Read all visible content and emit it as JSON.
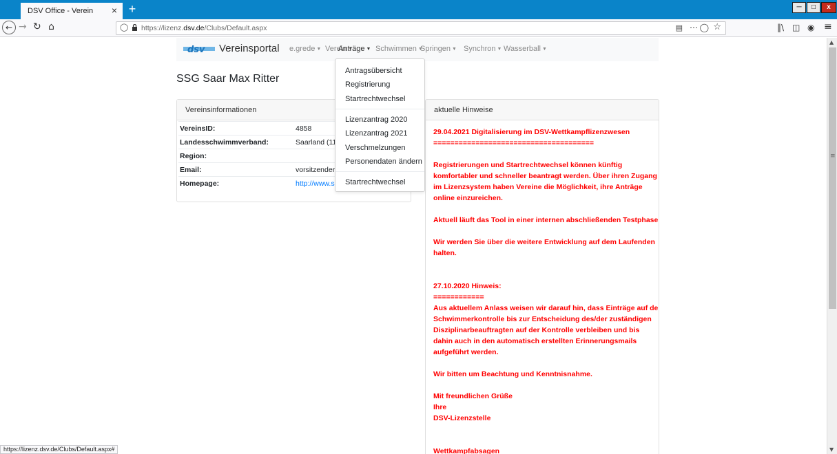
{
  "browser": {
    "tab_title": "DSV Office - Verein",
    "tab_close": "×",
    "new_tab": "+",
    "url_prefix": "https://lizenz.",
    "url_domain": "dsv.de",
    "url_path": "/Clubs/Default.aspx",
    "status_url": "https://lizenz.dsv.de/Clubs/Default.aspx#"
  },
  "site": {
    "brand": "Vereinsportal",
    "nav": {
      "egrede": "e.grede",
      "verein": "Verein",
      "antraege": "Anträge",
      "schwimmen": "Schwimmen",
      "springen": "Springen",
      "synchron": "Synchron",
      "wasserball": "Wasserball"
    },
    "dropdown": [
      "Antragsübersicht",
      "Registrierung",
      "Startrechtwechsel",
      "Lizenzantrag 2020",
      "Lizenzantrag 2021",
      "Verschmelzungen",
      "Personendaten ändern",
      "Startrechtwechsel"
    ]
  },
  "club": {
    "title": "SSG Saar Max Ritter",
    "card_title": "Vereinsinformationen",
    "rows": [
      {
        "label": "VereinsID:",
        "value": "4858"
      },
      {
        "label": "Landesschwimmverband:",
        "value": "Saarland (11)"
      },
      {
        "label": "Region:",
        "value": ""
      },
      {
        "label": "Email:",
        "value": "vorsitzender@"
      },
      {
        "label": "Homepage:",
        "value": "http://www.ss"
      }
    ]
  },
  "hints": {
    "card_title": "aktuelle Hinweise",
    "lines": [
      "29.04.2021 Digitalisierung im DSV-Wettkampflizenzwesen",
      "======================================",
      "",
      "Registrierungen und Startrechtwechsel können künftig",
      "komfortabler und schneller beantragt werden. Über ihren Zugang",
      "im Lizenzsystem haben Vereine die Möglichkeit, ihre Anträge",
      "online einzureichen.",
      "",
      "Aktuell läuft das Tool in einer internen abschließenden Testphase.",
      "",
      "Wir werden Sie über die weitere Entwicklung auf dem Laufenden",
      "halten.",
      "",
      "",
      "27.10.2020 Hinweis:",
      "============",
      "Aus aktuellem Anlass weisen wir darauf hin, dass Einträge auf der",
      "Schwimmerkontrolle bis zur Entscheidung des/der zuständigen",
      "Disziplinarbeauftragten auf der Kontrolle verbleiben und bis",
      "dahin auch in den automatisch erstellten Erinnerungsmails",
      "aufgeführt werden.",
      "",
      "Wir bitten um Beachtung und Kenntnisnahme.",
      "",
      "Mit freundlichen Grüße",
      "Ihre",
      "DSV-Lizenzstelle",
      "",
      "",
      "Wettkampfabsagen",
      "==============="
    ]
  },
  "colors": {
    "hint_red": "#ff0000",
    "link_blue": "#007bff",
    "logo_blue": "#1c75bc"
  }
}
